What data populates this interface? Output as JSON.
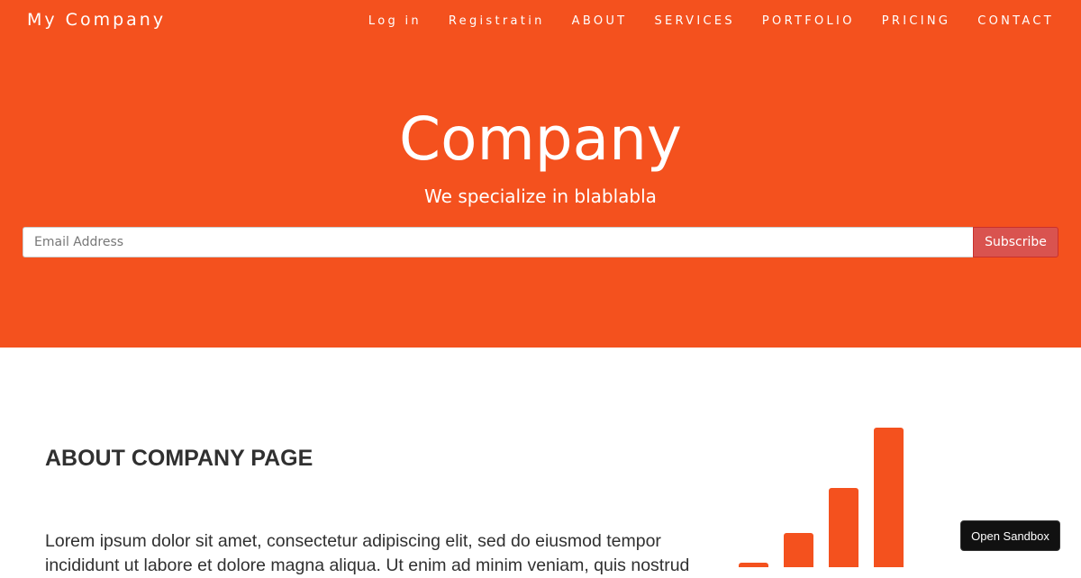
{
  "header": {
    "brand": "My Company",
    "nav": [
      {
        "label": "Log in"
      },
      {
        "label": "Registratin"
      },
      {
        "label": "ABOUT"
      },
      {
        "label": "SERVICES"
      },
      {
        "label": "PORTFOLIO"
      },
      {
        "label": "PRICING"
      },
      {
        "label": "CONTACT"
      }
    ]
  },
  "hero": {
    "title": "Company",
    "subtitle": "We specialize in blablabla",
    "email_placeholder": "Email Address",
    "email_value": "",
    "subscribe_label": "Subscribe"
  },
  "about": {
    "heading": "ABOUT COMPANY PAGE",
    "text": "Lorem ipsum dolor sit amet, consectetur adipiscing elit, sed do eiusmod tempor incididunt ut labore et dolore magna aliqua. Ut enim ad minim veniam, quis nostrud"
  },
  "icons": {
    "chart": "bar-chart-icon"
  },
  "colors": {
    "accent": "#f4511e",
    "subscribe_button": "#d9534f"
  },
  "sandbox": {
    "label": "Open Sandbox"
  }
}
